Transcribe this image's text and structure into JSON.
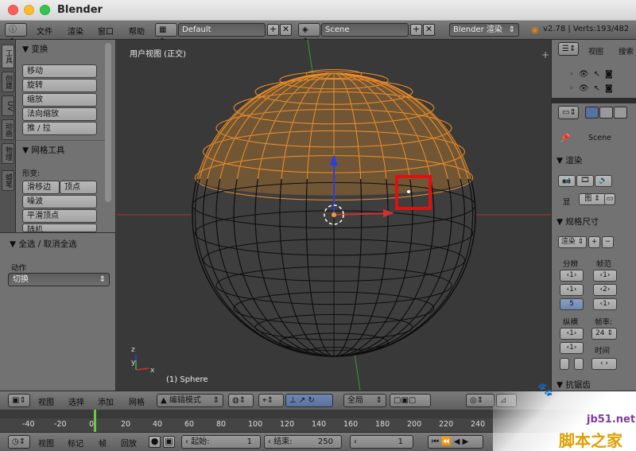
{
  "window": {
    "title": "Blender"
  },
  "info_header": {
    "menus": [
      "文件",
      "渲染",
      "窗口",
      "帮助"
    ],
    "screen_layout": "Default",
    "scene": "Scene",
    "render_engine": "Blender 渲染",
    "version_stats": "v2.78 | Verts:193/482"
  },
  "left_tabs": [
    "工具",
    "创建",
    "关系",
    "动画",
    "物理",
    "蜡笔"
  ],
  "left_tab_extra": "UV",
  "tool_shelf": {
    "transform_title": "▼ 变换",
    "transform_buttons": [
      "移动",
      "旋转",
      "缩放",
      "法向缩放",
      "推 / 拉"
    ],
    "mesh_tools_title": "▼ 网格工具",
    "deform_label": "形变:",
    "slide_edge": "滑移边",
    "vertex": "顶点",
    "mesh_buttons": [
      "噪波",
      "平滑顶点",
      "随机"
    ]
  },
  "operator_panel": {
    "title": "▼ 全选 / 取消全选",
    "action_label": "动作",
    "action_value": "切换"
  },
  "viewport": {
    "title": "用户视图 (正交)",
    "object_label": "(1) Sphere",
    "axes": {
      "x": "x",
      "y": "y",
      "z": "z"
    }
  },
  "outliner": {
    "view": "视图",
    "search": "搜索"
  },
  "properties": {
    "scene_name": "Scene",
    "render_section": "▼ 渲染",
    "display_label": "显",
    "display_value": "图",
    "dimensions_section": "▼ 规格尺寸",
    "preset_label": "渲染",
    "resolution_label": "分辨",
    "frame_range_label": "帧范",
    "res_fields": [
      "1",
      "1",
      "5"
    ],
    "frame_fields": [
      "1",
      "2",
      "1"
    ],
    "aspect_label": "纵横",
    "frame_rate_label": "帧率:",
    "aspect_fields": [
      "1",
      "1"
    ],
    "frame_rate_value": "24",
    "time_label": "时间",
    "anti_alias": "▼ 抗锯齿"
  },
  "viewport_header": {
    "menus": [
      "视图",
      "选择",
      "添加",
      "网格"
    ],
    "mode": "编辑模式",
    "pivot": "全局"
  },
  "timeline": {
    "ruler": [
      "-40",
      "-20",
      "0",
      "20",
      "40",
      "60",
      "80",
      "100",
      "120",
      "140",
      "160",
      "180",
      "200",
      "220",
      "240"
    ],
    "current_frame": "1"
  },
  "timeline_header": {
    "menus": [
      "视图",
      "标记",
      "帧",
      "回放"
    ],
    "start_label": "起始:",
    "start_value": "1",
    "end_label": "结束:",
    "end_value": "250",
    "current_value": "1"
  },
  "watermark": {
    "url": "jb51.net",
    "name": "脚本之家"
  },
  "colors": {
    "selected_orange": "#f0902a",
    "wire": "#0d0d0d",
    "highlight_box": "#e01010",
    "x_axis": "#d13030",
    "y_axis": "#3fae3f",
    "z_axis": "#2a3fe0"
  }
}
